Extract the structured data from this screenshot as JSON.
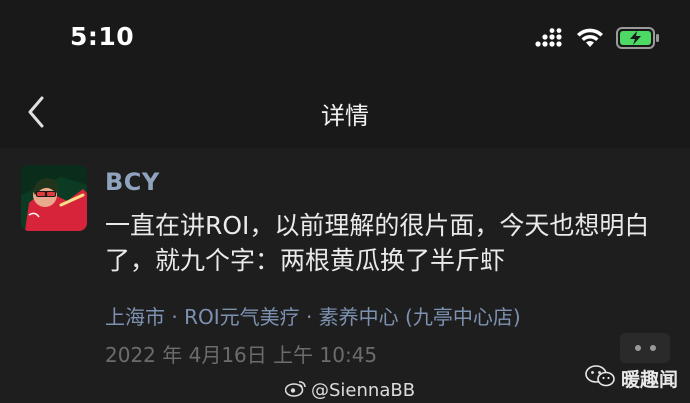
{
  "status_bar": {
    "time": "5:10",
    "icons": [
      "cellular-signal-icon",
      "wifi-icon",
      "battery-charging-icon"
    ]
  },
  "nav": {
    "title": "详情",
    "back_icon": "chevron-left-icon"
  },
  "post": {
    "username": "BCY",
    "message": "一直在讲ROI，以前理解的很片面，今天也想明白了，就九个字：两根黄瓜换了半斤虾",
    "location": "上海市 · ROI元气美疗 · 素养中心 (九亭中心店)",
    "timestamp": "2022 年 4月16日 上午 10:45"
  },
  "watermark": {
    "handle": "@SiennaBB",
    "icon": "weibo-icon"
  },
  "brand": {
    "name": "暖趣闻",
    "icon": "wechat-icon"
  },
  "colors": {
    "background": "#191919",
    "username": "#8fa3bf",
    "location": "#7d92b1",
    "battery": "#4cd964"
  }
}
